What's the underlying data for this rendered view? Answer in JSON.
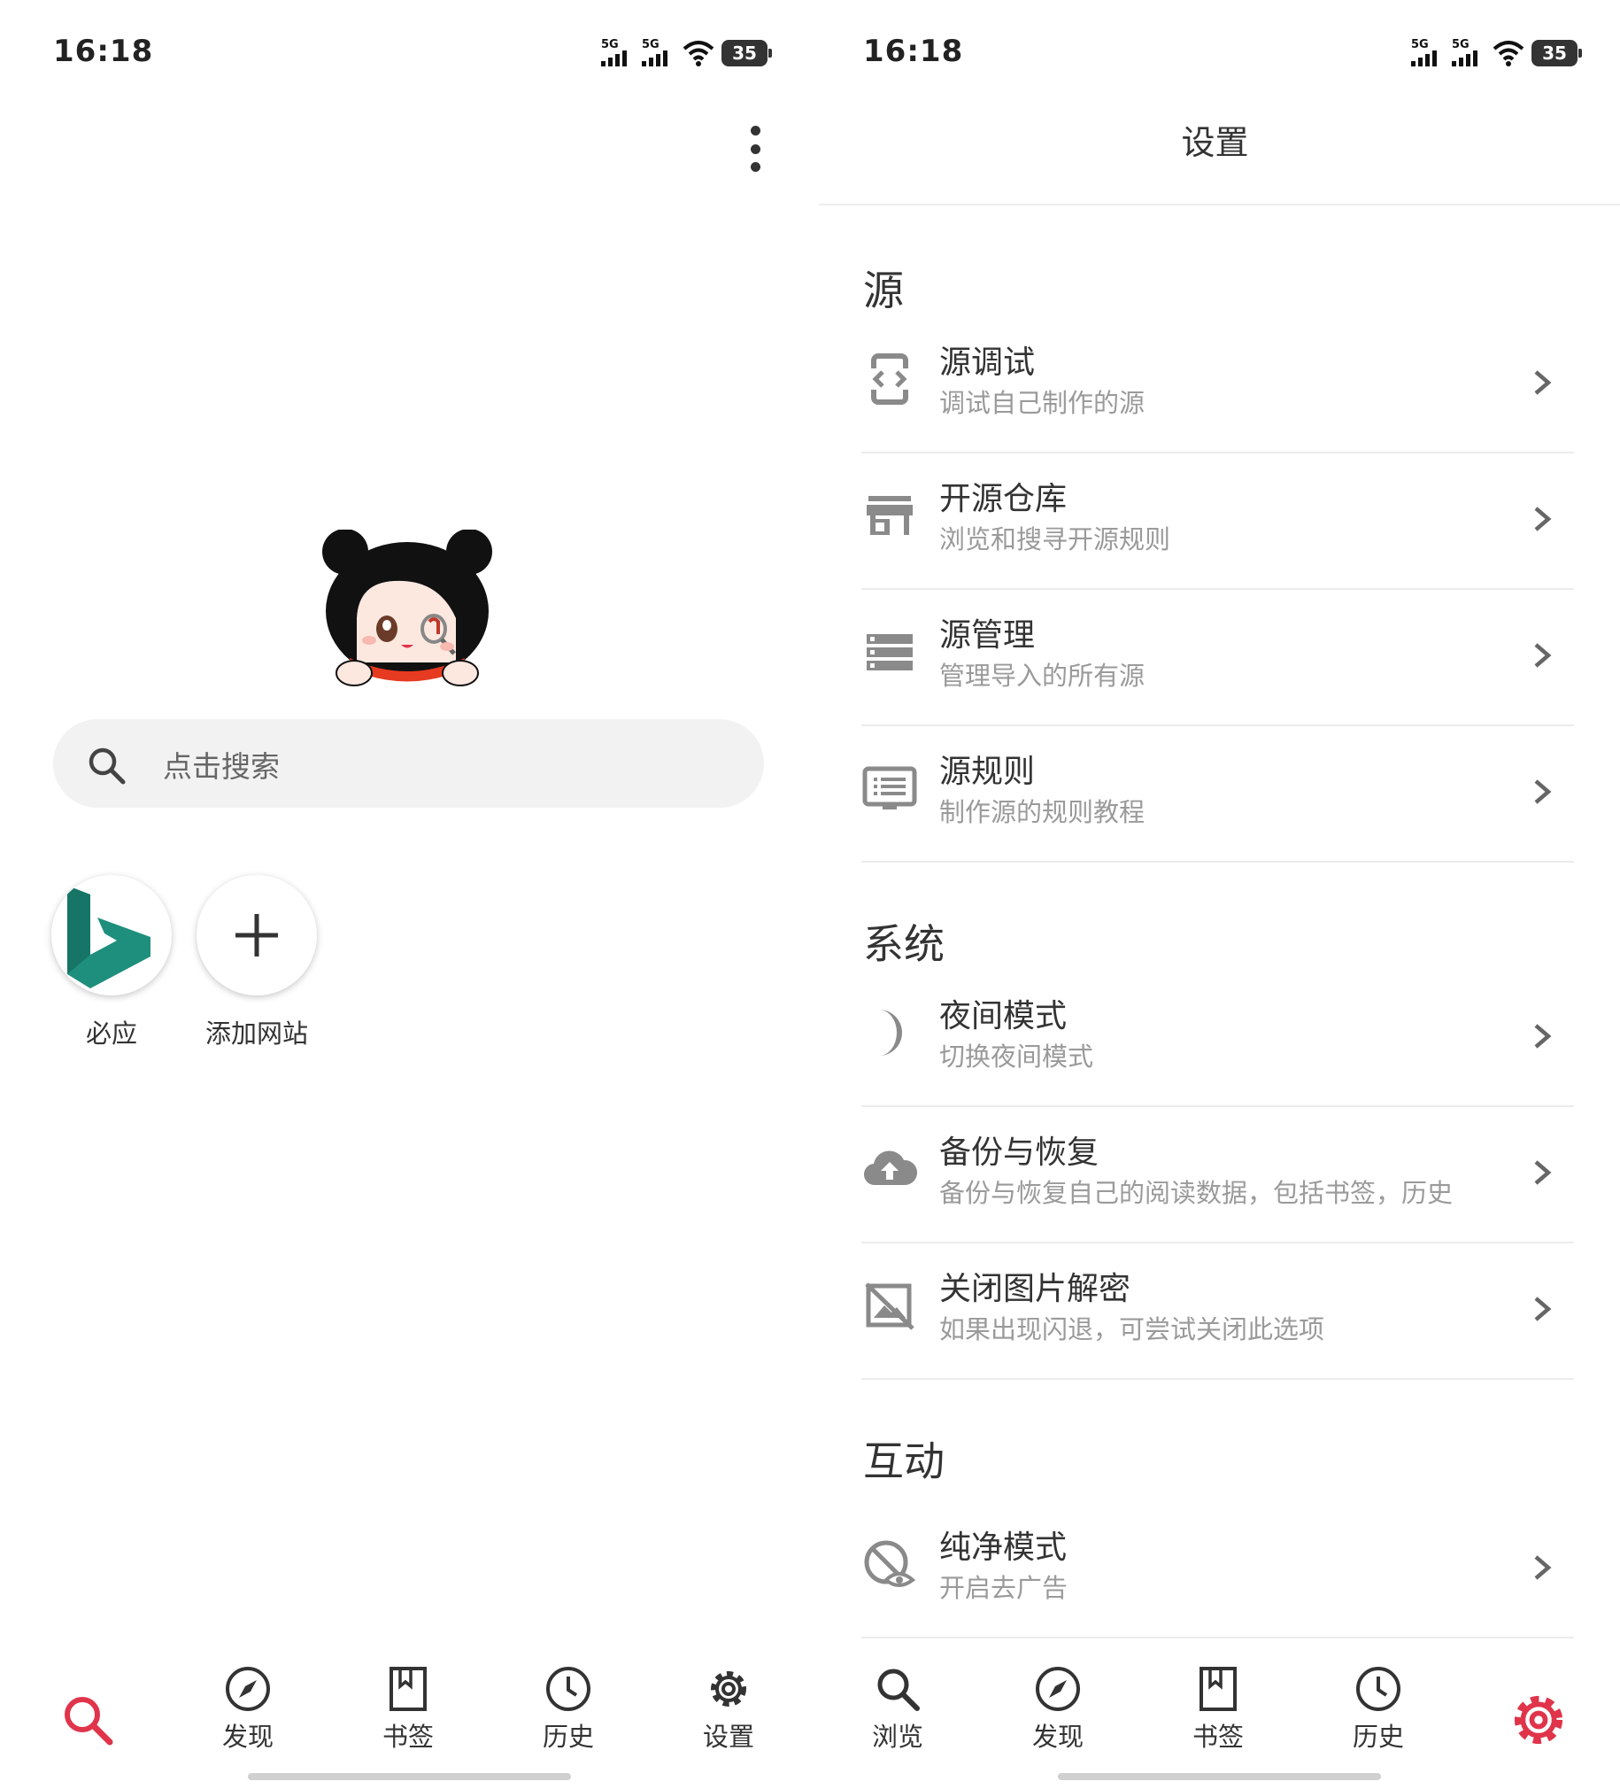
{
  "left": {
    "status": {
      "time": "16:18",
      "signal1": "5G",
      "signal2": "5G",
      "battery": "35"
    },
    "search": {
      "placeholder": "点击搜索"
    },
    "sites": [
      {
        "label": "必应"
      },
      {
        "label": "添加网站"
      }
    ],
    "nav": [
      {
        "label": ""
      },
      {
        "label": "发现"
      },
      {
        "label": "书签"
      },
      {
        "label": "历史"
      },
      {
        "label": "设置"
      }
    ]
  },
  "right": {
    "status": {
      "time": "16:18",
      "signal1": "5G",
      "signal2": "5G",
      "battery": "35"
    },
    "title": "设置",
    "sections": [
      {
        "title": "源",
        "items": [
          {
            "title": "源调试",
            "subtitle": "调试自己制作的源",
            "icon": "code-bracket-icon"
          },
          {
            "title": "开源仓库",
            "subtitle": "浏览和搜寻开源规则",
            "icon": "store-icon"
          },
          {
            "title": "源管理",
            "subtitle": "管理导入的所有源",
            "icon": "list-icon"
          },
          {
            "title": "源规则",
            "subtitle": "制作源的规则教程",
            "icon": "document-icon"
          }
        ]
      },
      {
        "title": "系统",
        "items": [
          {
            "title": "夜间模式",
            "subtitle": "切换夜间模式",
            "icon": "moon-icon"
          },
          {
            "title": "备份与恢复",
            "subtitle": "备份与恢复自己的阅读数据，包括书签，历史",
            "icon": "cloud-upload-icon"
          },
          {
            "title": "关闭图片解密",
            "subtitle": "如果出现闪退，可尝试关闭此选项",
            "icon": "image-off-icon"
          }
        ]
      },
      {
        "title": "互动",
        "items": [
          {
            "title": "纯净模式",
            "subtitle": "开启去广告",
            "icon": "eye-off-icon"
          }
        ]
      }
    ],
    "nav": [
      {
        "label": "浏览"
      },
      {
        "label": "发现"
      },
      {
        "label": "书签"
      },
      {
        "label": "历史"
      },
      {
        "label": ""
      }
    ]
  },
  "colors": {
    "accent": "#e0344b",
    "bing": "#1f8f7d",
    "icon_gray": "#8a8a8a"
  }
}
